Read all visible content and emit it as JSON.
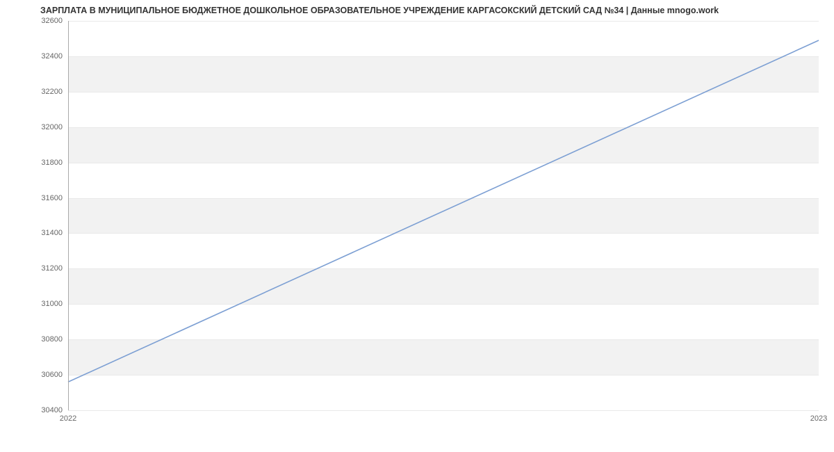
{
  "chart_data": {
    "type": "line",
    "title": "ЗАРПЛАТА В МУНИЦИПАЛЬНОЕ БЮДЖЕТНОЕ ДОШКОЛЬНОЕ ОБРАЗОВАТЕЛЬНОЕ УЧРЕЖДЕНИЕ КАРГАСОКСКИЙ ДЕТСКИЙ САД №34 | Данные mnogo.work",
    "xlabel": "",
    "ylabel": "",
    "x_categories": [
      "2022",
      "2023"
    ],
    "y_ticks": [
      30400,
      30600,
      30800,
      31000,
      31200,
      31400,
      31600,
      31800,
      32000,
      32200,
      32400,
      32600
    ],
    "ylim": [
      30400,
      32600
    ],
    "series": [
      {
        "name": "Зарплата",
        "x": [
          "2022",
          "2023"
        ],
        "values": [
          30560,
          32490
        ]
      }
    ],
    "grid": {
      "horizontal": true,
      "vertical": false,
      "banded": true
    },
    "legend": false,
    "line_color": "#7c9fd3"
  }
}
